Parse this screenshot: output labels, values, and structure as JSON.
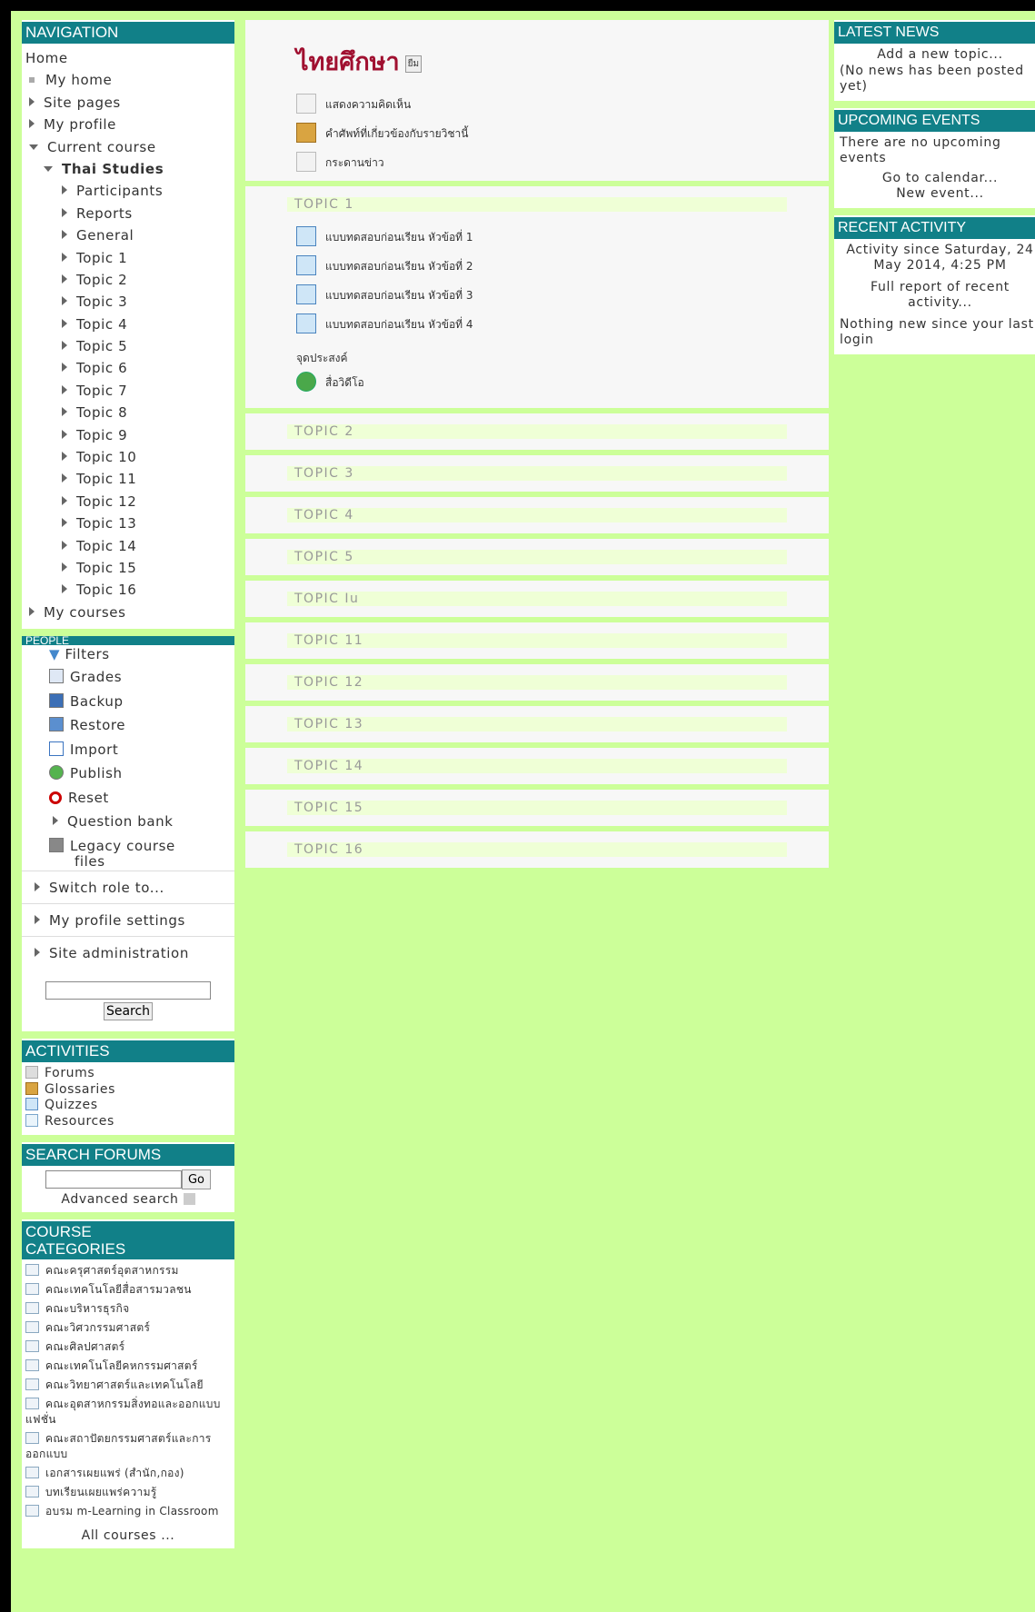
{
  "navigation": {
    "title": "NAVIGATION",
    "home": "Home",
    "my_home": "My home",
    "site_pages": "Site pages",
    "my_profile": "My profile",
    "current_course": "Current course",
    "course_short": "Thai Studies",
    "course_items": [
      "Participants",
      "Reports",
      "General",
      "Topic 1",
      "Topic 2",
      "Topic 3",
      "Topic 4",
      "Topic 5",
      "Topic 6",
      "Topic 7",
      "Topic 8",
      "Topic 9",
      "Topic 10",
      "Topic 11",
      "Topic 12",
      "Topic 13",
      "Topic 14",
      "Topic 15",
      "Topic 16"
    ],
    "my_courses": "My courses"
  },
  "settings": {
    "title_partial": "PEOPLE",
    "filters": "Filters",
    "items": [
      "Grades",
      "Backup",
      "Restore",
      "Import",
      "Publish",
      "Reset"
    ],
    "question_bank": "Question bank",
    "legacy_files_1": "Legacy course",
    "legacy_files_2": "files",
    "switch_role": "Switch role to...",
    "my_profile_settings": "My profile settings",
    "site_admin": "Site administration",
    "search_button": "Search"
  },
  "activities": {
    "title": "ACTIVITIES",
    "items": [
      "Forums",
      "Glossaries",
      "Quizzes",
      "Resources"
    ]
  },
  "search_forums": {
    "title": "SEARCH FORUMS",
    "go": "Go",
    "advanced": "Advanced search"
  },
  "course_categories": {
    "title_1": "COURSE",
    "title_2": "CATEGORIES",
    "items": [
      "คณะครุศาสตร์อุตสาหกรรม",
      "คณะเทคโนโลยีสื่อสารมวลชน",
      "คณะบริหารธุรกิจ",
      "คณะวิศวกรรมศาสตร์",
      "คณะศิลปศาสตร์",
      "คณะเทคโนโลยีคหกรรมศาสตร์",
      "คณะวิทยาศาสตร์และเทคโนโลยี",
      "คณะอุตสาหกรรมสิ่งทอและออกแบบแฟชั่น",
      "คณะสถาปัตยกรรมศาสตร์และการออกแบบ",
      "เอกสารเผยแพร่ (สำนัก,กอง)",
      "บทเรียนเผยแพร่ความรู้",
      "อบรม m-Learning in Classroom"
    ],
    "all_courses": "All courses ..."
  },
  "main": {
    "course_title": "ไทยศึกษา",
    "edit_label": "ยืม",
    "general_items": [
      "แสดงความคิดเห็น",
      "คำศัพท์ที่เกี่ยวข้องกับรายวิชานี้",
      "กระดานข่าว"
    ],
    "topic1_label": "TOPIC 1",
    "topic1_items": [
      "แบบทดสอบก่อนเรียน หัวข้อที่ 1",
      "แบบทดสอบก่อนเรียน หัวข้อที่ 2",
      "แบบทดสอบก่อนเรียน หัวข้อที่ 3",
      "แบบทดสอบก่อนเรียน หัวข้อที่ 4"
    ],
    "objective_label": "จุดประสงค์",
    "video_label": "สื่อวิดีโอ",
    "topics": [
      "TOPIC 2",
      "TOPIC 3",
      "TOPIC 4",
      "TOPIC 5",
      "TOPIC Iu",
      "TOPIC 11",
      "TOPIC 12",
      "TOPIC 13",
      "TOPIC 14",
      "TOPIC 15",
      "TOPIC 16"
    ]
  },
  "right": {
    "news_title": "LATEST NEWS",
    "news_add": "Add a new topic...",
    "news_none": "(No news has been posted yet)",
    "events_title": "UPCOMING EVENTS",
    "events_none": "There are no upcoming events",
    "calendar_link": "Go to calendar...",
    "new_event": "New event...",
    "activity_title": "RECENT ACTIVITY",
    "activity_since": "Activity since Saturday, 24 May 2014, 4:25 PM",
    "full_report": "Full report of recent activity...",
    "nothing_new": "Nothing new since your last login"
  }
}
